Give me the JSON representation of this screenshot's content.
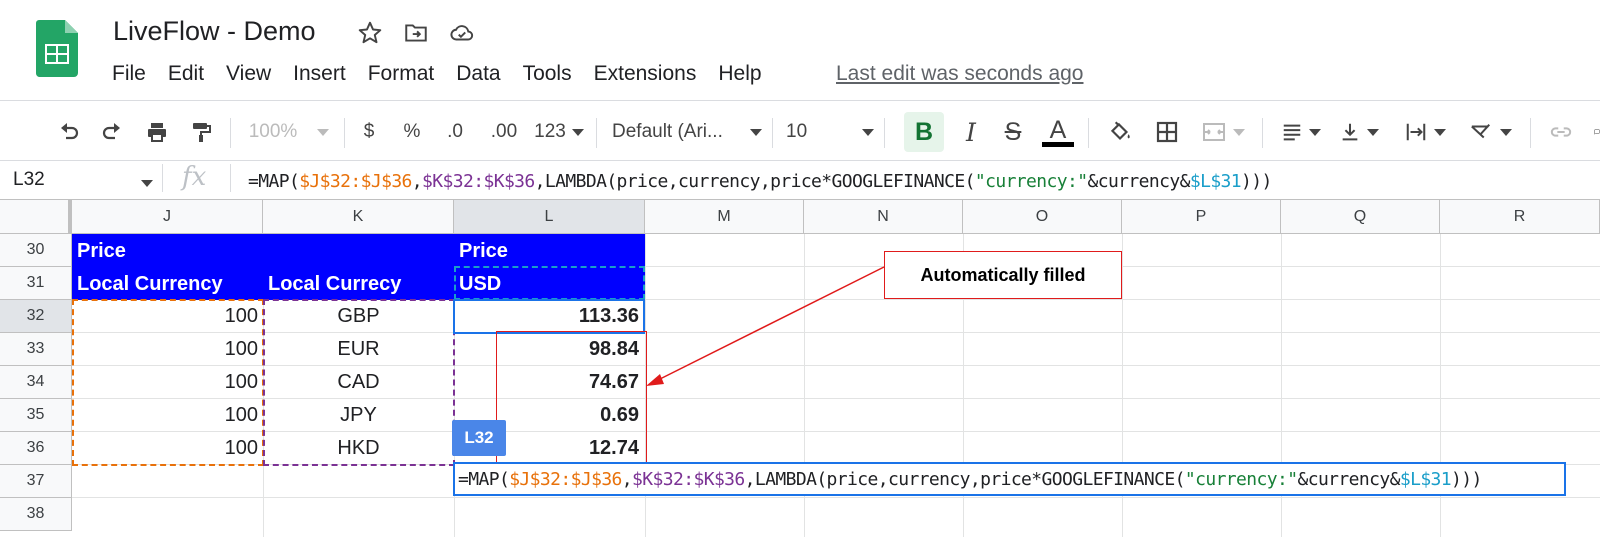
{
  "app": {
    "doc_title": "LiveFlow - Demo",
    "last_edit": "Last edit was seconds ago",
    "menu": [
      "File",
      "Edit",
      "View",
      "Insert",
      "Format",
      "Data",
      "Tools",
      "Extensions",
      "Help"
    ]
  },
  "toolbar": {
    "zoom": "100%",
    "currency": "$",
    "percent": "%",
    "dec_decrease": ".0",
    "dec_increase": ".00",
    "more_formats": "123",
    "font": "Default (Ari...",
    "font_size": "10",
    "bold": "B",
    "italic": "I",
    "strike": "S",
    "text_color": "A"
  },
  "formula_bar": {
    "name_box": "L32",
    "fx": "fx",
    "formula_parts": {
      "p1": "=MAP(",
      "p2": "$J$32:$J$36",
      "p3": ",",
      "p4": "$K$32:$K$36",
      "p5": ",LAMBDA(price,currency,price*GOOGLEFINANCE(",
      "p6": "\"currency:\"",
      "p7": "&currency&",
      "p8": "$L$31",
      "p9": ")))"
    }
  },
  "columns": [
    "J",
    "K",
    "L",
    "M",
    "N",
    "O",
    "P",
    "Q",
    "R"
  ],
  "rows": [
    "30",
    "31",
    "32",
    "33",
    "34",
    "35",
    "36",
    "37",
    "38"
  ],
  "cells": {
    "J30": "Price",
    "J31": "Local Currency",
    "K31": "Local Currecy",
    "L30": "Price",
    "L31": "USD",
    "J_values": [
      "100",
      "100",
      "100",
      "100",
      "100"
    ],
    "K_values": [
      "GBP",
      "EUR",
      "CAD",
      "JPY",
      "HKD"
    ],
    "L_values": [
      "113.36",
      "98.84",
      "74.67",
      "0.69",
      "12.74"
    ]
  },
  "annotation": "Automatically filled",
  "cell_tag": "L32",
  "colors": {
    "header_fill": "#0000ff",
    "selection": "#1a73e8",
    "range_j": "#e8710a",
    "range_k": "#7b3294",
    "range_l": "#1a9ec9",
    "annotation": "#e01b1b"
  }
}
